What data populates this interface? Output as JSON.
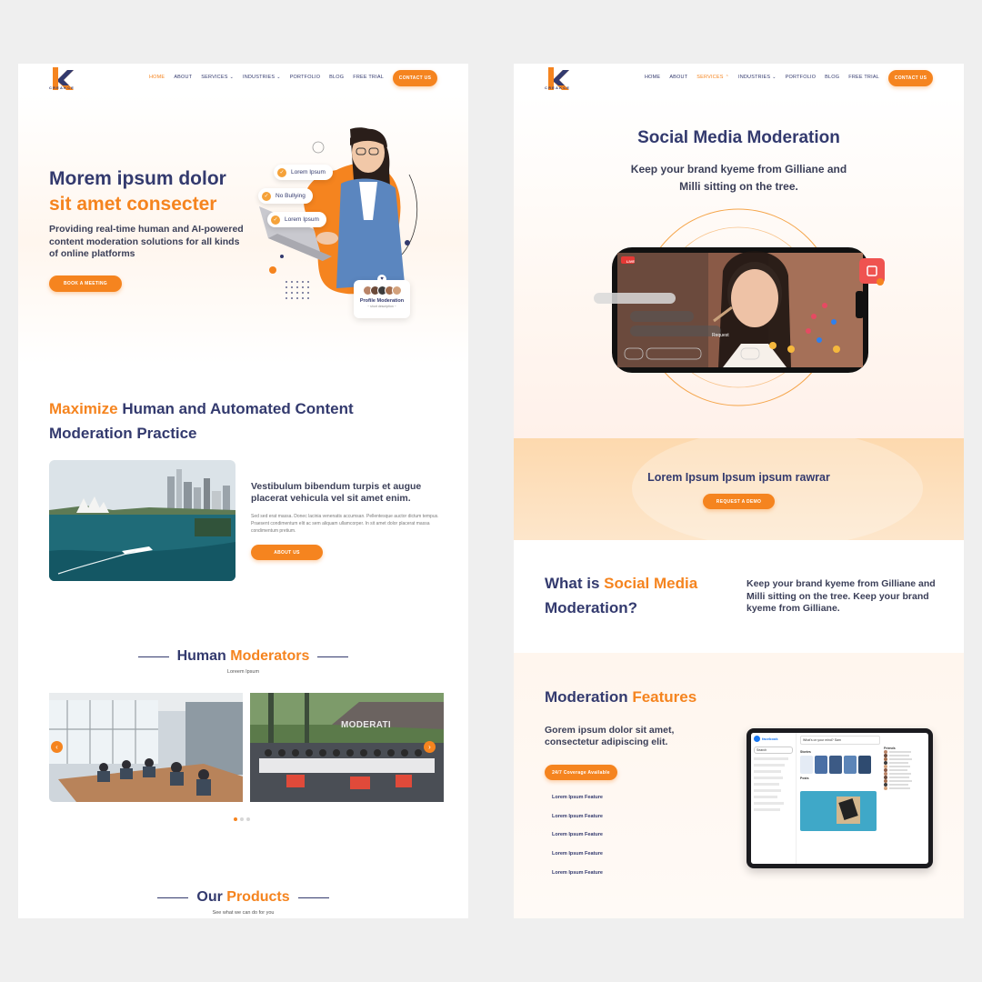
{
  "left": {
    "logo_text": "CREAKCE",
    "nav": {
      "items": [
        "HOME",
        "ABOUT",
        "SERVICES",
        "INDUSTRIES",
        "PORTFOLIO",
        "BLOG",
        "FREE TRIAL"
      ],
      "active": "HOME",
      "cta": "CONTACT US"
    },
    "hero": {
      "title_line1": "Morem ipsum dolor",
      "title_line2": "sit amet consecter",
      "subtitle": "Providing real-time human and AI-powered content moderation solutions for all kinds of online platforms",
      "button": "BOOK A MEETING",
      "pills": [
        "Lorem Ipsum",
        "No Bullying",
        "Lorem Ipsum"
      ],
      "profile_card_title": "Profile Moderation",
      "profile_card_sub": "~ short description ~"
    },
    "practice": {
      "title_highlight": "Maximize",
      "title_rest": " Human and Automated Content",
      "title_line2": "Moderation Practice",
      "card_title": "Vestibulum bibendum turpis et augue placerat vehicula vel sit amet enim.",
      "card_body": "Sed sed erat massa. Donec lacinia venenatis accumsan. Pellentesque auctor dictum tempus. Praesent condimentum elit ac sem aliquam ullamcorper. In sit amet dolor placerat massa condimentum pretium.",
      "button": "ABOUT US"
    },
    "moderators": {
      "title_a": "Human",
      "title_b": " Moderators",
      "subtitle": "Loreem Ipsum",
      "banner_text": "MODERATI"
    },
    "products": {
      "title_a": "Our",
      "title_b": " Products",
      "subtitle": "See what we can do for you"
    }
  },
  "right": {
    "logo_text": "CREAKCE",
    "nav": {
      "items": [
        "HOME",
        "ABOUT",
        "SERVICES",
        "INDUSTRIES",
        "PORTFOLIO",
        "BLOG",
        "FREE TRIAL"
      ],
      "active": "SERVICES",
      "cta": "CONTACT US"
    },
    "hero": {
      "title": "Social Media Moderation",
      "subtitle_line1": "Keep your brand kyeme from Gilliane and",
      "subtitle_line2": "Milli sitting on the tree.",
      "live_badge": "LIVE",
      "request_label": "Request"
    },
    "cta_band": {
      "title": "Lorem Ipsum Ipsum ipsum rawrar",
      "button": "REQUEST A DEMO"
    },
    "what_is": {
      "title_a": "What is ",
      "title_b": "Social Media",
      "title_c": "Moderation?",
      "text": "Keep your brand kyeme from Gilliane and Milli sitting on the tree. Keep your brand kyeme from Gilliane."
    },
    "features": {
      "title_a": "Moderation",
      "title_b": " Features",
      "subtitle": "Gorem ipsum dolor sit amet, consectetur adipiscing elit.",
      "badge": "24/7 Coverage Available",
      "items": [
        "Lorem Ipsum Feature",
        "Lorem Ipsum Feature",
        "Lorem Ipsum Feature",
        "Lorem Ipsum Feature",
        "Lorem Ipsum Feature"
      ],
      "tablet_brand": "facebook",
      "tablet_search": "Search",
      "tablet_stories": "Stories",
      "tablet_posts": "Posts",
      "tablet_friends": "Friends",
      "tablet_feed_prompt": "What's on your mind? Sam"
    }
  },
  "colors": {
    "navy": "#333a6e",
    "orange": "#f5841f",
    "peach": "#fde2c2"
  }
}
